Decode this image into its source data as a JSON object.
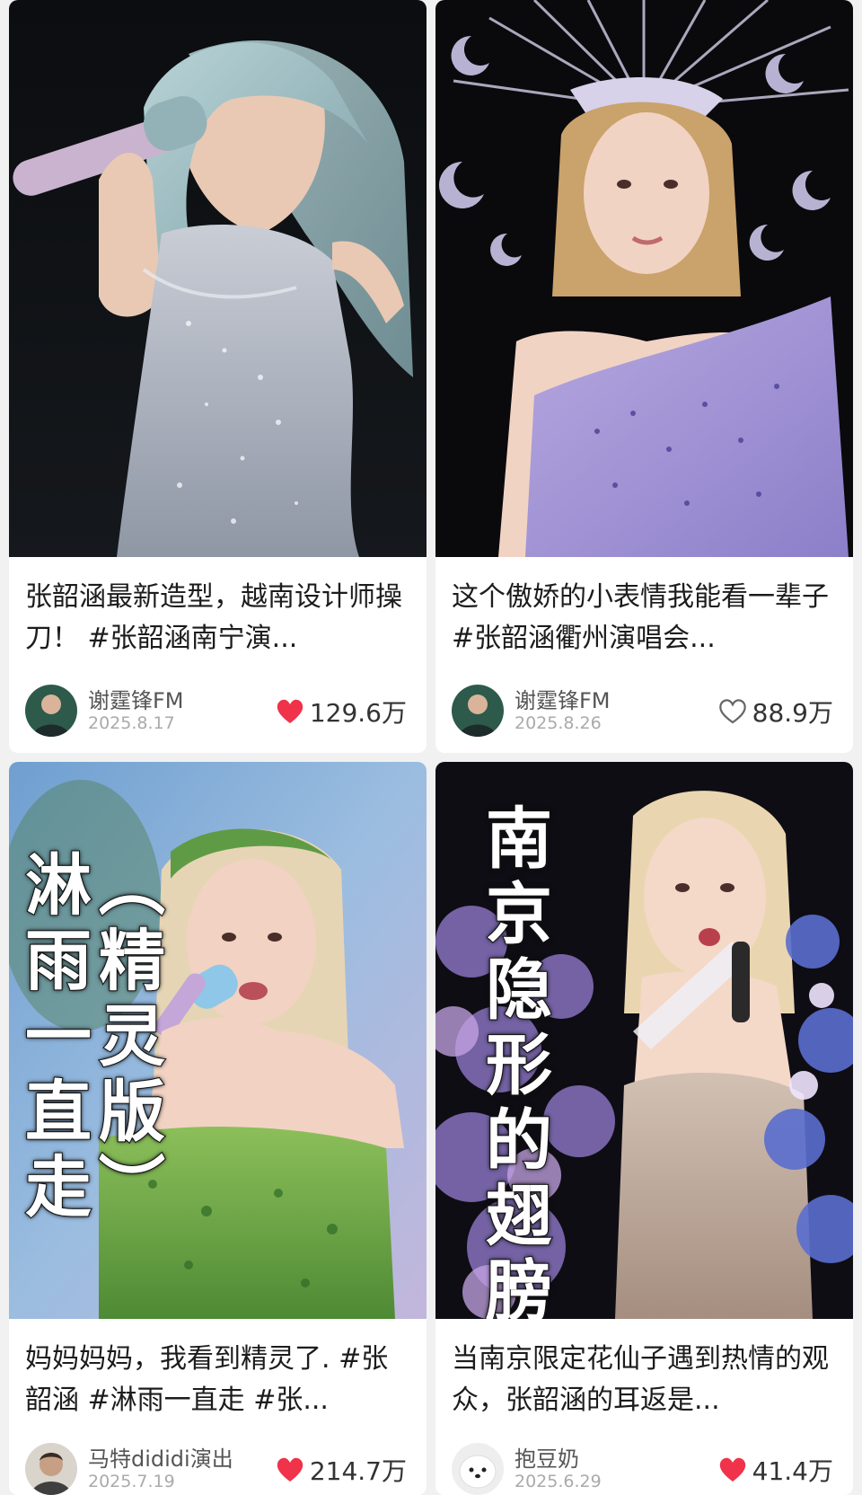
{
  "cards": [
    {
      "caption": "张韶涵最新造型，越南设计师操刀！ #张韶涵南宁演...",
      "author": "谢霆锋FM",
      "date": "2025.8.17",
      "likes": "129.6万",
      "liked": true,
      "overlay": []
    },
    {
      "caption": "这个傲娇的小表情我能看一辈子 #张韶涵衢州演唱会...",
      "author": "谢霆锋FM",
      "date": "2025.8.26",
      "likes": "88.9万",
      "liked": false,
      "overlay": []
    },
    {
      "caption": "妈妈妈妈，我看到精灵了. #张韶涵 #淋雨一直走 #张...",
      "author": "马特dididi演出",
      "date": "2025.7.19",
      "likes": "214.7万",
      "liked": true,
      "overlay": [
        [
          "淋",
          "雨",
          "一",
          "直",
          "走"
        ],
        [
          "︵",
          "精",
          "灵",
          "版",
          "︶"
        ]
      ]
    },
    {
      "caption": "当南京限定花仙子遇到热情的观众，张韶涵的耳返是...",
      "author": "抱豆奶",
      "date": "2025.6.29",
      "likes": "41.4万",
      "liked": true,
      "overlay": [
        [
          "南",
          "京",
          "隐",
          "形",
          "的",
          "翅",
          "膀"
        ]
      ]
    }
  ],
  "colors": {
    "like_red": "#f0324a",
    "like_outline": "#666666",
    "page_bg": "#f1f1f1"
  },
  "icons": {
    "liked": "heart-filled-icon",
    "not_liked": "heart-outline-icon"
  }
}
